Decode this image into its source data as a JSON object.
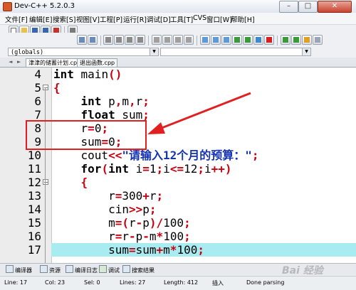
{
  "window": {
    "title": "Dev-C++ 5.2.0.3",
    "controls": [
      "–",
      "□",
      "✕"
    ]
  },
  "menu": [
    "文件[F]",
    "编辑[E]",
    "搜索[S]",
    "视图[V]",
    "工程[P]",
    "运行[R]",
    "调试[D]",
    "工具[T]",
    "CVS",
    "窗口[W]",
    "帮助[H]"
  ],
  "toolbar": {
    "dropdown_scope": "(globals)",
    "dropdown_symbol": ""
  },
  "tabs": [
    "津津的储蓄计划.cpp",
    "退出函数.cpp"
  ],
  "code_lines": [
    {
      "num": "4",
      "fold": "",
      "parts": [
        [
          "kw",
          "int"
        ],
        [
          "",
          " main"
        ],
        [
          "op",
          "()"
        ]
      ]
    },
    {
      "num": "5",
      "fold": "⊟",
      "parts": [
        [
          "op",
          "{"
        ]
      ]
    },
    {
      "num": "6",
      "fold": "",
      "parts": [
        [
          "",
          "    "
        ],
        [
          "kw",
          "int"
        ],
        [
          "",
          " p"
        ],
        [
          "op",
          ","
        ],
        [
          "",
          "m"
        ],
        [
          "op",
          ","
        ],
        [
          "",
          "r"
        ],
        [
          "op",
          ";"
        ]
      ]
    },
    {
      "num": "7",
      "fold": "",
      "parts": [
        [
          "",
          "    "
        ],
        [
          "kw",
          "float"
        ],
        [
          "",
          " sum"
        ],
        [
          "op",
          ";"
        ]
      ]
    },
    {
      "num": "8",
      "fold": "",
      "parts": [
        [
          "",
          "    r"
        ],
        [
          "op",
          "="
        ],
        [
          "num",
          "0"
        ],
        [
          "op",
          ";"
        ]
      ]
    },
    {
      "num": "9",
      "fold": "",
      "parts": [
        [
          "",
          "    sum"
        ],
        [
          "op",
          "="
        ],
        [
          "num",
          "0"
        ],
        [
          "op",
          ";"
        ]
      ]
    },
    {
      "num": "10",
      "fold": "",
      "parts": [
        [
          "",
          "    cout"
        ],
        [
          "op",
          "<<"
        ],
        [
          "str",
          "\"请输入12个月的预算：\""
        ],
        [
          "op",
          ";"
        ]
      ]
    },
    {
      "num": "11",
      "fold": "",
      "parts": [
        [
          "",
          "    "
        ],
        [
          "kw",
          "for"
        ],
        [
          "op",
          "("
        ],
        [
          "kw",
          "int"
        ],
        [
          "",
          " i"
        ],
        [
          "op",
          "="
        ],
        [
          "num",
          "1"
        ],
        [
          "op",
          ";"
        ],
        [
          "",
          "i"
        ],
        [
          "op",
          "<="
        ],
        [
          "num",
          "12"
        ],
        [
          "op",
          ";"
        ],
        [
          "",
          "i"
        ],
        [
          "op",
          "++)"
        ]
      ]
    },
    {
      "num": "12",
      "fold": "⊟",
      "parts": [
        [
          "",
          "    "
        ],
        [
          "op",
          "{"
        ]
      ]
    },
    {
      "num": "13",
      "fold": "",
      "parts": [
        [
          "",
          "        r"
        ],
        [
          "op",
          "="
        ],
        [
          "num",
          "300"
        ],
        [
          "op",
          "+"
        ],
        [
          "",
          "r"
        ],
        [
          "op",
          ";"
        ]
      ]
    },
    {
      "num": "14",
      "fold": "",
      "parts": [
        [
          "",
          "        cin"
        ],
        [
          "op",
          ">>"
        ],
        [
          "",
          "p"
        ],
        [
          "op",
          ";"
        ]
      ]
    },
    {
      "num": "15",
      "fold": "",
      "parts": [
        [
          "",
          "        m"
        ],
        [
          "op",
          "=("
        ],
        [
          "",
          "r"
        ],
        [
          "op",
          "-"
        ],
        [
          "",
          "p"
        ],
        [
          "op",
          ")/"
        ],
        [
          "num",
          "100"
        ],
        [
          "op",
          ";"
        ]
      ]
    },
    {
      "num": "16",
      "fold": "",
      "parts": [
        [
          "",
          "        r"
        ],
        [
          "op",
          "="
        ],
        [
          "",
          "r"
        ],
        [
          "op",
          "-"
        ],
        [
          "",
          "p"
        ],
        [
          "op",
          "-"
        ],
        [
          "",
          "m"
        ],
        [
          "op",
          "*"
        ],
        [
          "num",
          "100"
        ],
        [
          "op",
          ";"
        ]
      ]
    },
    {
      "num": "17",
      "fold": "",
      "highlight": true,
      "parts": [
        [
          "",
          "        sum"
        ],
        [
          "op",
          "="
        ],
        [
          "",
          "sum"
        ],
        [
          "op",
          "+"
        ],
        [
          "",
          "m"
        ],
        [
          "op",
          "*"
        ],
        [
          "num",
          "100"
        ],
        [
          "op",
          ";"
        ]
      ]
    }
  ],
  "bottom_tabs": [
    "编译器",
    "资源",
    "编译日志",
    "调试",
    "搜索结果"
  ],
  "status": {
    "line": "Line:   17",
    "col": "Col:   23",
    "sel": "Sel:   0",
    "lines": "Lines:   27",
    "length": "Length:   412",
    "mode": "插入",
    "state": "Done parsing"
  },
  "watermark": "Bai 经验",
  "colors": {
    "accent_red": "#e02020",
    "operator_red": "#c8000f",
    "string_blue": "#1432b4",
    "highlight_line": "#a8ecf2"
  }
}
